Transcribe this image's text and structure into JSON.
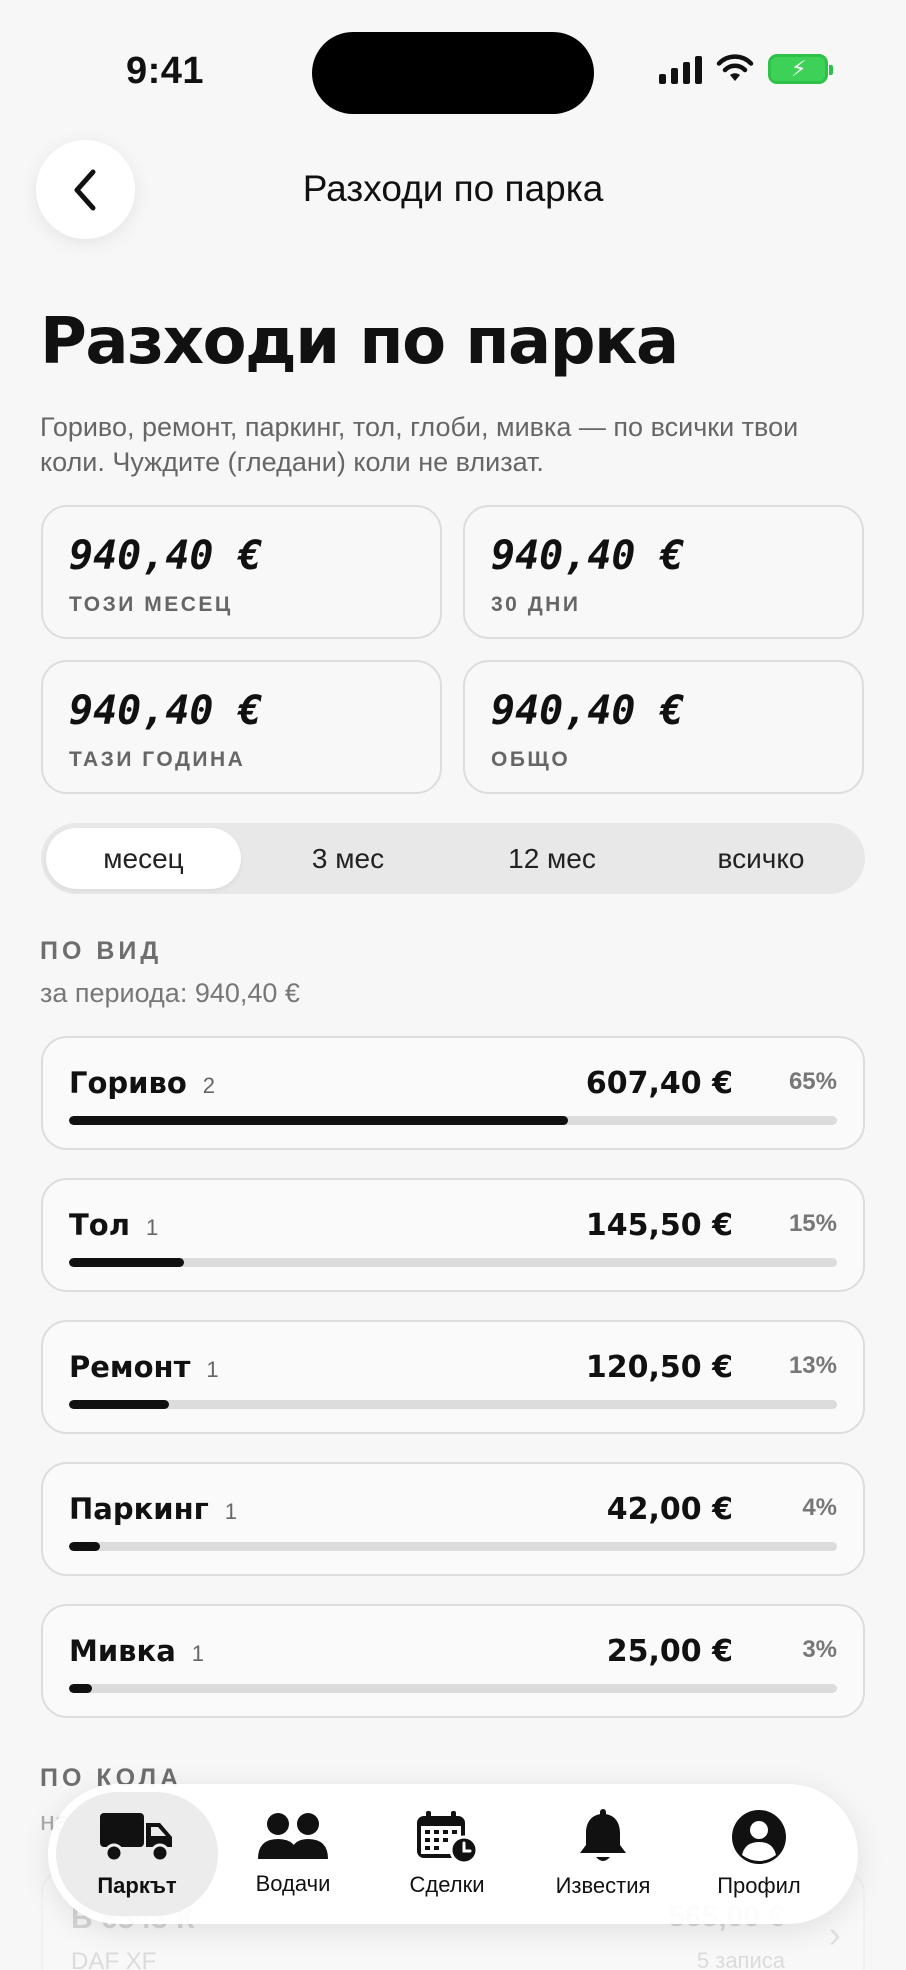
{
  "status": {
    "time": "9:41"
  },
  "nav": {
    "title": "Разходи по парка"
  },
  "header": {
    "title": "Разходи по парка",
    "subtitle": "Гориво, ремонт, паркинг, тол, глоби, мивка — по всички твои коли. Чуждите (гледани) коли не влизат."
  },
  "stats": [
    {
      "value": "940,40 €",
      "label": "ТОЗИ МЕСЕЦ"
    },
    {
      "value": "940,40 €",
      "label": "30 ДНИ"
    },
    {
      "value": "940,40 €",
      "label": "ТАЗИ ГОДИНА"
    },
    {
      "value": "940,40 €",
      "label": "ОБЩО"
    }
  ],
  "periods": [
    {
      "label": "месец",
      "active": true
    },
    {
      "label": "3 мес",
      "active": false
    },
    {
      "label": "12 мес",
      "active": false
    },
    {
      "label": "всичко",
      "active": false
    }
  ],
  "by_type": {
    "heading": "ПО ВИД",
    "subtitle": "за периода: 940,40 €",
    "items": [
      {
        "name": "Гориво",
        "count": "2",
        "amount": "607,40 €",
        "percent": "65%",
        "share": 0.65
      },
      {
        "name": "Тол",
        "count": "1",
        "amount": "145,50 €",
        "percent": "15%",
        "share": 0.15
      },
      {
        "name": "Ремонт",
        "count": "1",
        "amount": "120,50 €",
        "percent": "13%",
        "share": 0.13
      },
      {
        "name": "Паркинг",
        "count": "1",
        "amount": "42,00 €",
        "percent": "4%",
        "share": 0.04
      },
      {
        "name": "Мивка",
        "count": "1",
        "amount": "25,00 €",
        "percent": "3%",
        "share": 0.03
      }
    ]
  },
  "by_car": {
    "heading": "ПО КОЛА",
    "subtitle": "на",
    "item": {
      "name": "В 6543 К",
      "model": "DAF XF",
      "amount": "565,00 €",
      "records": "5 записа"
    }
  },
  "tabs": [
    {
      "label": "Паркът",
      "icon": "truck-icon",
      "active": true
    },
    {
      "label": "Водачи",
      "icon": "people-icon",
      "active": false
    },
    {
      "label": "Сделки",
      "icon": "calendar-clock-icon",
      "active": false
    },
    {
      "label": "Известия",
      "icon": "bell-icon",
      "active": false
    },
    {
      "label": "Профил",
      "icon": "person-icon",
      "active": false
    }
  ]
}
